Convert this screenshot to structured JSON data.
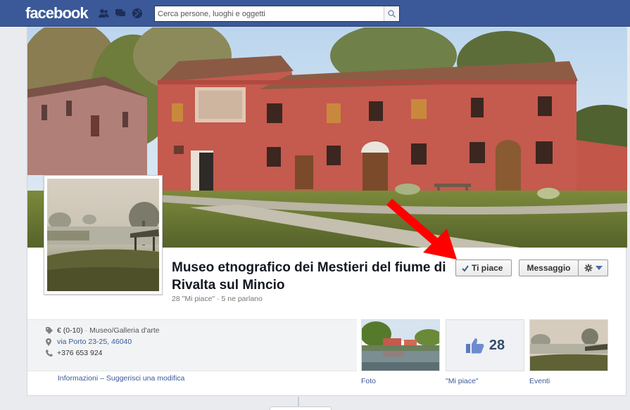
{
  "topbar": {
    "logo": "facebook",
    "jewels": [
      {
        "icon": "friend-requests-icon"
      },
      {
        "icon": "messages-icon"
      },
      {
        "icon": "notifications-globe-icon"
      }
    ],
    "search": {
      "placeholder": "Cerca persone, luoghi e oggetti",
      "button_icon": "search-icon"
    }
  },
  "page": {
    "title": "Museo etnografico dei Mestieri del fiume di Rivalta sul Mincio",
    "likes_line": "28 \"Mi piace\" · 5 ne parlano",
    "actions": {
      "like_label": "Ti piace",
      "like_icon": "checkmark-icon",
      "message_label": "Messaggio",
      "gear_icon": "gear-icon",
      "dropdown_icon": "caret-down-icon"
    },
    "annotation": {
      "arrow_color": "#ff0000"
    },
    "info": {
      "category_price": "€ (0-10)",
      "category_sep": "·",
      "category": "Museo/Galleria d'arte",
      "address": "via Porto 23-25, 46040",
      "phone": "+376 653 924"
    },
    "sub_links": {
      "info": "Informazioni",
      "sep": "–",
      "suggest": "Suggerisci una modifica"
    },
    "tiles": {
      "foto_label": "Foto",
      "likes_count": "28",
      "likes_label": "\"Mi piace\"",
      "eventi_label": "Eventi"
    }
  },
  "colors": {
    "brand": "#3b5998",
    "link": "#3b5998",
    "background": "#e9ebee"
  }
}
